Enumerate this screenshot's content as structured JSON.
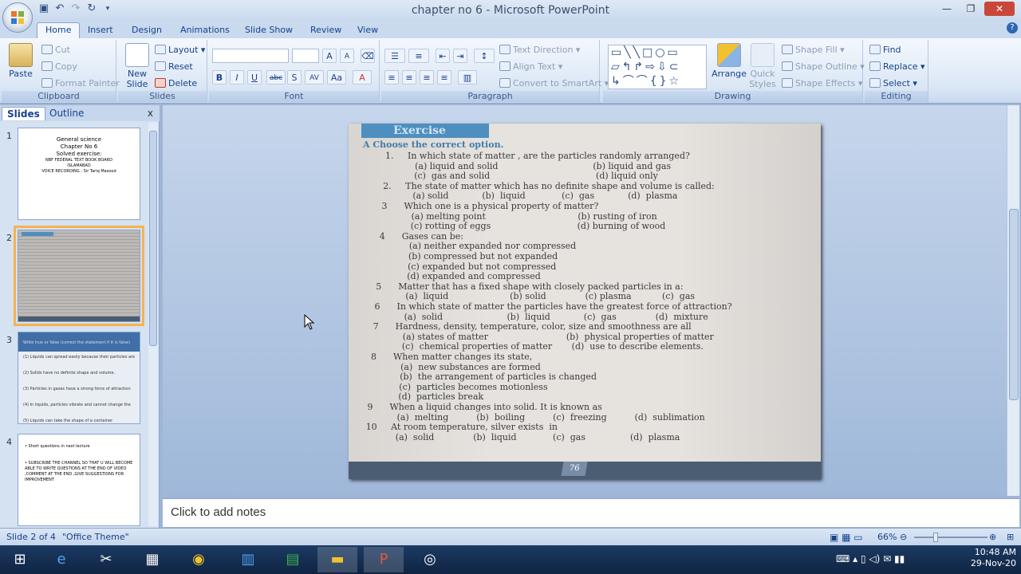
{
  "window": {
    "title": "chapter no 6 - Microsoft PowerPoint",
    "minimize": "—",
    "maximize": "❐",
    "close": "✕"
  },
  "quick_access": [
    "save-icon",
    "undo-icon",
    "redo-icon",
    "customize-icon"
  ],
  "tabs": [
    "Home",
    "Insert",
    "Design",
    "Animations",
    "Slide Show",
    "Review",
    "View"
  ],
  "help": "?",
  "ribbon": {
    "clipboard": {
      "label": "Clipboard",
      "paste": "Paste",
      "cut": "Cut",
      "copy": "Copy",
      "format_painter": "Format Painter"
    },
    "slides": {
      "label": "Slides",
      "new_slide_1": "New",
      "new_slide_2": "Slide",
      "layout": "Layout",
      "reset": "Reset",
      "delete": "Delete"
    },
    "font": {
      "label": "Font",
      "buttons": [
        "B",
        "I",
        "U",
        "abc",
        "S",
        "AV",
        "Aa",
        "A"
      ]
    },
    "paragraph": {
      "label": "Paragraph",
      "text_direction": "Text Direction",
      "align_text": "Align Text",
      "convert_smartart": "Convert to SmartArt"
    },
    "drawing": {
      "label": "Drawing",
      "arrange": "Arrange",
      "quick_styles_1": "Quick",
      "quick_styles_2": "Styles",
      "shape_fill": "Shape Fill",
      "shape_outline": "Shape Outline",
      "shape_effects": "Shape Effects"
    },
    "editing": {
      "label": "Editing",
      "find": "Find",
      "replace": "Replace",
      "select": "Select"
    }
  },
  "panel": {
    "tab_slides": "Slides",
    "tab_outline": "Outline",
    "close": "x",
    "thumbs": [
      {
        "num": "1",
        "lines": [
          "General science",
          "Chapter No 6",
          "Solved exercise:",
          "",
          "NBF FEDERAL TEXT BOOK BOARD",
          "ISLAMABAD",
          "VOICE RECORDING : Sir Tariq Masood"
        ]
      },
      {
        "num": "2"
      },
      {
        "num": "3",
        "lines": [
          "Write true or false (correct the statement if it is false)",
          "(1) Liquids can spread easily because their particles are",
          "(2) Solids have no definite shape and volume.",
          "(3) Particles in gases have a strong force of attraction",
          "(4) In liquids, particles vibrate and cannot change the",
          "(5) Liquids can take the shape of a container"
        ]
      },
      {
        "num": "4",
        "lines": [
          "• Short questions in next lecture",
          "• SUBSCRIBE THE CHANNEL SO THAT U WILL BECOME ABLE TO WRITE QUESTIONS AT THE END OF VIDEO ,COMMENT AT THE END ,GIVE SUGGESTIONS FOR IMPROVEMENT"
        ]
      }
    ]
  },
  "slide": {
    "header": "Exercise",
    "instruction": "A  Choose the correct option.",
    "lines": [
      "1.     In which state of matter , are the particles randomly arranged?",
      "(a) liquid and solid                                  (b) liquid and gas",
      "(c)  gas and solid                                      (d) liquid only",
      "2.     The state of matter which has no definite shape and volume is called:",
      "(a) solid            (b)  liquid             (c)  gas            (d)  plasma",
      "3      Which one is a physical property of matter?",
      "(a) melting point                                 (b) rusting of iron",
      "(c) rotting of eggs                               (d) burning of wood",
      "4      Gases can be:",
      "(a) neither expanded nor compressed",
      "(b) compressed but not expanded",
      "(c) expanded but not compressed",
      "(d) expanded and compressed",
      "5      Matter that has a fixed shape with closely packed particles in a:",
      "(a)  liquid                      (b) solid              (c) plasma           (c)  gas",
      "6      In which state of matter the particles have the greatest force of attraction?",
      "(a)  solid                       (b)  liquid            (c)  gas              (d)  mixture",
      "7      Hardness, density, temperature, color, size and smoothness are all",
      "(a) states of matter                            (b)  physical properties of matter",
      "(c)  chemical properties of matter       (d)  use to describe elements.",
      "8      When matter changes its state,",
      "(a)  new substances are formed",
      "(b)  the arrangement of particles is changed",
      "(c)  particles becomes motionless",
      "(d)  particles break",
      "9      When a liquid changes into solid. It is known as",
      "(a)  melting          (b)  boiling          (c)  freezing          (d)  sublimation",
      "10     At room temperature, silver exists  in",
      "(a)  solid              (b)  liquid             (c)  gas                (d)  plasma"
    ],
    "page_number": "76"
  },
  "notes_placeholder": "Click to add notes",
  "status": {
    "slide_info": "Slide 2 of 4",
    "theme": "\"Office Theme\"",
    "zoom": "66%"
  },
  "taskbar": {
    "time": "10:48 AM",
    "date": "29-Nov-20"
  }
}
